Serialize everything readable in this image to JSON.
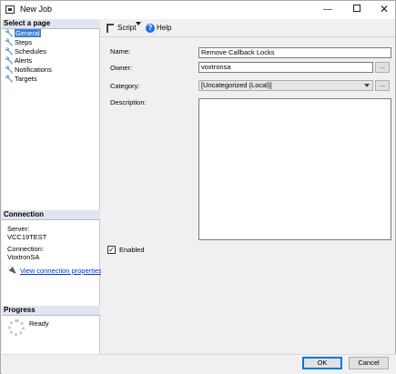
{
  "window": {
    "title": "New Job"
  },
  "left": {
    "select_page_header": "Select a page",
    "pages": [
      {
        "label": "General",
        "active": true
      },
      {
        "label": "Steps",
        "active": false
      },
      {
        "label": "Schedules",
        "active": false
      },
      {
        "label": "Alerts",
        "active": false
      },
      {
        "label": "Notifications",
        "active": false
      },
      {
        "label": "Targets",
        "active": false
      }
    ],
    "connection_header": "Connection",
    "server_label": "Server:",
    "server_value": "VCC19TEST",
    "connection_label": "Connection:",
    "connection_value": "VoxtronSA",
    "view_link": "View connection properties",
    "progress_header": "Progress",
    "progress_status": "Ready"
  },
  "toolbar": {
    "script_label": "Script",
    "help_label": "Help",
    "help_icon_glyph": "?"
  },
  "form": {
    "name_label": "Name:",
    "name_value": "Remove Callback Locks",
    "owner_label": "Owner:",
    "owner_value": "voxtronsa",
    "category_label": "Category:",
    "category_value": "[Uncategorized (Local)]",
    "description_label": "Description:",
    "ellipsis": "...",
    "enabled_label": "Enabled",
    "enabled_checked": true
  },
  "footer": {
    "ok_label": "OK",
    "cancel_label": "Cancel"
  }
}
